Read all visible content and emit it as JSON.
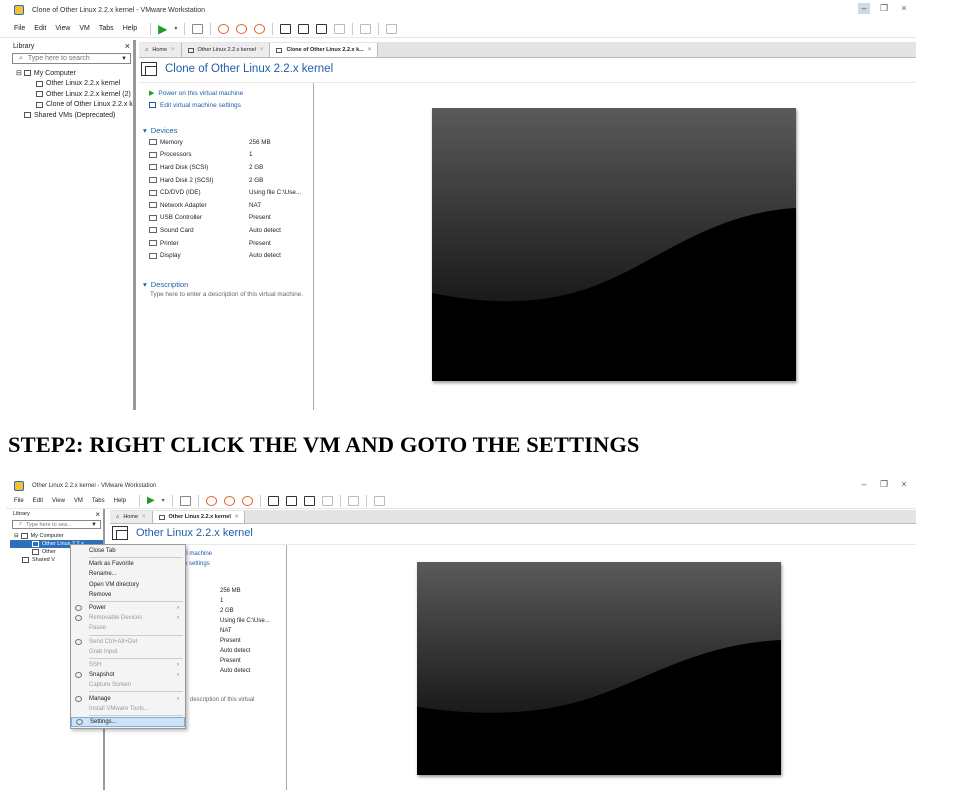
{
  "step_heading": "STEP2: RIGHT CLICK THE VM  AND GOTO THE SETTINGS",
  "shot1": {
    "window_title": "Clone of Other Linux 2.2.x kernel - VMware Workstation",
    "menu": [
      "File",
      "Edit",
      "View",
      "VM",
      "Tabs",
      "Help"
    ],
    "library": {
      "title": "Library",
      "close": "×",
      "search_placeholder": "Type here to search",
      "tree": [
        "My Computer",
        "Other Linux 2.2.x kernel",
        "Other Linux 2.2.x kernel (2)",
        "Clone of Other Linux 2.2.x k",
        "Shared VMs (Deprecated)"
      ]
    },
    "tabs": [
      "Home",
      "Other Linux 2.2.x kernel",
      "Clone of Other Linux 2.2.x k..."
    ],
    "vm_name": "Clone of Other Linux 2.2.x kernel",
    "actions": [
      "Power on this virtual machine",
      "Edit virtual machine settings"
    ],
    "devices_label": "Devices",
    "devices": [
      {
        "name": "Memory",
        "value": "256 MB"
      },
      {
        "name": "Processors",
        "value": "1"
      },
      {
        "name": "Hard Disk (SCSI)",
        "value": "2 GB"
      },
      {
        "name": "Hard Disk 2 (SCSI)",
        "value": "2 GB"
      },
      {
        "name": "CD/DVD (IDE)",
        "value": "Using file C:\\Use..."
      },
      {
        "name": "Network Adapter",
        "value": "NAT"
      },
      {
        "name": "USB Controller",
        "value": "Present"
      },
      {
        "name": "Sound Card",
        "value": "Auto detect"
      },
      {
        "name": "Printer",
        "value": "Present"
      },
      {
        "name": "Display",
        "value": "Auto detect"
      }
    ],
    "description_label": "Description",
    "description_text": "Type here to enter a description of this virtual machine."
  },
  "shot2": {
    "window_title": "Other Linux 2.2.x kernel - VMware Workstation",
    "menu": [
      "File",
      "Edit",
      "View",
      "VM",
      "Tabs",
      "Help"
    ],
    "library": {
      "title": "Library",
      "close": "×",
      "search_placeholder": "Type here to sea...",
      "tree": [
        "My Computer",
        "Other Linux 2.2.x",
        "Other",
        "Shared V"
      ]
    },
    "tabs": [
      "Home",
      "Other Linux 2.2.x kernel"
    ],
    "vm_name": "Other Linux 2.2.x kernel",
    "partial_actions": [
      "rtual machine",
      "hine settings"
    ],
    "partial_values": [
      "256 MB",
      "1",
      "2 GB",
      "Using file C:\\Use...",
      "NAT",
      "Present",
      "Auto detect",
      "Present",
      "Auto detect"
    ],
    "partial_description": "description of this virtual",
    "context_menu": [
      {
        "label": "Close Tab",
        "disabled": false
      },
      {
        "sep": true
      },
      {
        "label": "Mark as Favorite",
        "disabled": false
      },
      {
        "label": "Rename...",
        "disabled": false
      },
      {
        "label": "Open VM directory",
        "disabled": false
      },
      {
        "label": "Remove",
        "disabled": false
      },
      {
        "sep": true
      },
      {
        "label": "Power",
        "disabled": false,
        "submenu": true,
        "icon": "power-icon"
      },
      {
        "label": "Removable Devices",
        "disabled": true,
        "submenu": true,
        "icon": "devices-icon"
      },
      {
        "label": "Pause",
        "disabled": true
      },
      {
        "sep": true
      },
      {
        "label": "Send Ctrl+Alt+Del",
        "disabled": true,
        "icon": "keyboard-icon"
      },
      {
        "label": "Grab Input",
        "disabled": true
      },
      {
        "sep": true
      },
      {
        "label": "SSH",
        "disabled": true,
        "submenu": true
      },
      {
        "label": "Snapshot",
        "disabled": false,
        "submenu": true,
        "icon": "snapshot-icon"
      },
      {
        "label": "Capture Screen",
        "disabled": true
      },
      {
        "sep": true
      },
      {
        "label": "Manage",
        "disabled": false,
        "submenu": true,
        "icon": "wrench-icon"
      },
      {
        "label": "Install VMware Tools...",
        "disabled": true
      },
      {
        "sep": true
      },
      {
        "label": "Settings...",
        "disabled": false,
        "highlighted": true,
        "icon": "settings-icon"
      }
    ]
  }
}
